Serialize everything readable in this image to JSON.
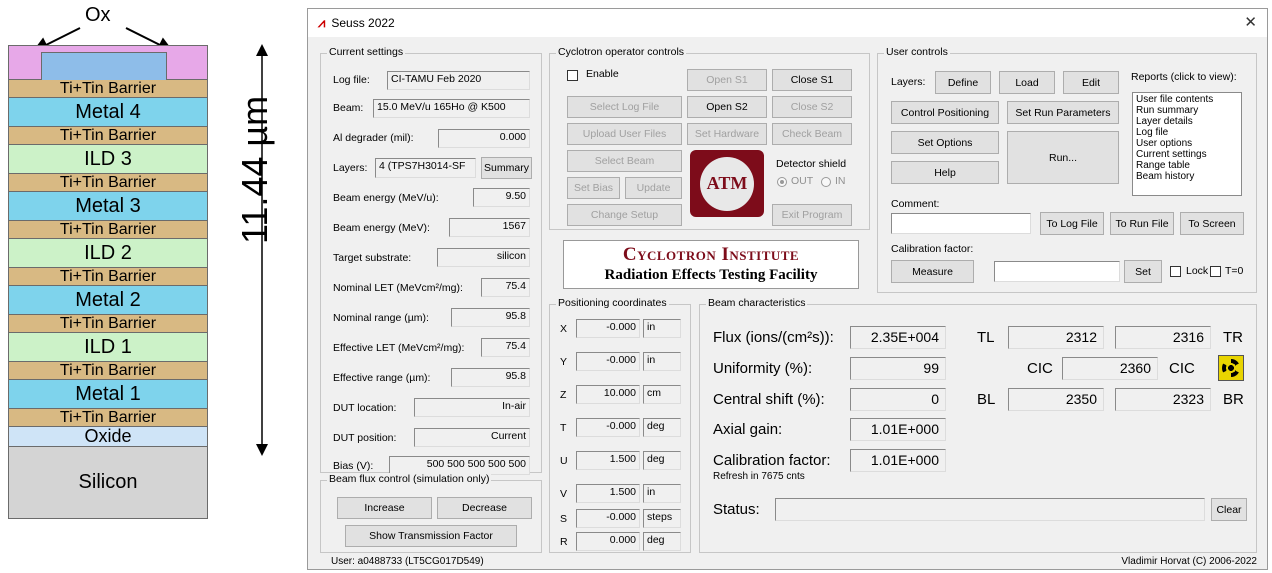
{
  "diagram": {
    "ox_label": "Ox",
    "height_label": "11.44 µm",
    "layers": [
      "Ti+Tin Barrier",
      "Metal 4",
      "Ti+Tin Barrier",
      "ILD 3",
      "Ti+Tin Barrier",
      "Metal 3",
      "Ti+Tin Barrier",
      "ILD 2",
      "Ti+Tin Barrier",
      "Metal 2",
      "Ti+Tin Barrier",
      "ILD 1",
      "Ti+Tin Barrier",
      "Metal 1",
      "Ti+Tin Barrier",
      "Oxide",
      "Silicon"
    ],
    "colors": {
      "barrier": "#d8b983",
      "metal": "#7ed3ec",
      "ild": "#ccf2c8",
      "oxide": "#cfe4f7",
      "silicon": "#d4d4d4",
      "cap": "#e7a8e8"
    }
  },
  "window": {
    "title": "Seuss 2022",
    "close_icon": "close-icon",
    "status_left": "User: a0488733 (LT5CG017D549)",
    "status_right": "Vladimir Horvat (C) 2006-2022"
  },
  "current_settings": {
    "title": "Current settings",
    "rows": [
      {
        "label": "Log file:",
        "value": "CI-TAMU Feb 2020"
      },
      {
        "label": "Beam:",
        "value": "15.0 MeV/u 165Ho @ K500"
      },
      {
        "label": "Al degrader (mil):",
        "value": "0.000"
      },
      {
        "label": "Layers:",
        "value": "4 (TPS7H3014-SF"
      },
      {
        "label": "Beam energy (MeV/u):",
        "value": "9.50"
      },
      {
        "label": "Beam energy (MeV):",
        "value": "1567"
      },
      {
        "label": "Target substrate:",
        "value": "silicon"
      },
      {
        "label": "Nominal LET (MeVcm²/mg):",
        "value": "75.4"
      },
      {
        "label": "Nominal range (µm):",
        "value": "95.8"
      },
      {
        "label": "Effective LET (MeVcm²/mg):",
        "value": "75.4"
      },
      {
        "label": "Effective range (µm):",
        "value": "95.8"
      },
      {
        "label": "DUT location:",
        "value": "In-air"
      },
      {
        "label": "DUT position:",
        "value": "Current"
      },
      {
        "label": "Bias (V):",
        "value": "500 500 500 500 500"
      }
    ],
    "summary_button": "Summary"
  },
  "beam_flux": {
    "title": "Beam flux control (simulation only)",
    "increase": "Increase",
    "decrease": "Decrease",
    "transmission": "Show Transmission Factor"
  },
  "cyclotron": {
    "title": "Cyclotron operator controls",
    "enable": "Enable",
    "buttons": {
      "open_s1": "Open S1",
      "close_s1": "Close S1",
      "select_log": "Select Log File",
      "open_s2": "Open S2",
      "close_s2": "Close S2",
      "upload": "Upload User Files",
      "set_hardware": "Set Hardware",
      "check_beam": "Check Beam",
      "select_beam": "Select Beam",
      "set_bias": "Set Bias",
      "update": "Update",
      "change_setup": "Change Setup",
      "exit": "Exit Program"
    },
    "detector_shield": "Detector shield",
    "out": "OUT",
    "in": "IN",
    "logo_text": "ATM",
    "institute_line1": "Cyclotron Institute",
    "institute_line2": "Radiation Effects Testing Facility"
  },
  "positioning": {
    "title": "Positioning coordinates",
    "rows": [
      {
        "axis": "X",
        "value": "-0.000",
        "unit": "in"
      },
      {
        "axis": "Y",
        "value": "-0.000",
        "unit": "in"
      },
      {
        "axis": "Z",
        "value": "10.000",
        "unit": "cm"
      },
      {
        "axis": "T",
        "value": "-0.000",
        "unit": "deg"
      },
      {
        "axis": "U",
        "value": "1.500",
        "unit": "deg"
      },
      {
        "axis": "V",
        "value": "1.500",
        "unit": "in"
      },
      {
        "axis": "S",
        "value": "-0.000",
        "unit": "steps"
      },
      {
        "axis": "R",
        "value": "0.000",
        "unit": "deg"
      }
    ]
  },
  "user_controls": {
    "title": "User controls",
    "layers_label": "Layers:",
    "define": "Define",
    "load": "Load",
    "edit": "Edit",
    "control_positioning": "Control Positioning",
    "set_run_parameters": "Set Run Parameters",
    "set_options": "Set Options",
    "help": "Help",
    "run": "Run...",
    "reports_label": "Reports (click to view):",
    "reports": [
      "User file contents",
      "Run summary",
      "Layer details",
      "Log file",
      "User options",
      "Current settings",
      "Range table",
      "Beam history"
    ],
    "comment_label": "Comment:",
    "to_log": "To Log File",
    "to_run": "To Run File",
    "to_screen": "To Screen",
    "calib_label": "Calibration factor:",
    "measure": "Measure",
    "set": "Set",
    "lock": "Lock",
    "t0": "T=0"
  },
  "beam_char": {
    "title": "Beam characteristics",
    "flux_label": "Flux (ions/(cm²s)):",
    "flux": "2.35E+004",
    "uniformity_label": "Uniformity (%):",
    "uniformity": "99",
    "central_label": "Central shift (%):",
    "central": "0",
    "axial_label": "Axial gain:",
    "axial": "1.01E+000",
    "calib_label": "Calibration factor:",
    "calib": "1.01E+000",
    "refresh": "Refresh in 7675 cnts",
    "tl": "TL",
    "tr": "TR",
    "bl": "BL",
    "br": "BR",
    "cic": "CIC",
    "tl_val": "2312",
    "tr_val": "2316",
    "cic_val": "2360",
    "bl_val": "2350",
    "br_val": "2323",
    "status_label": "Status:",
    "clear": "Clear",
    "radiation_icon": "radiation-icon"
  }
}
